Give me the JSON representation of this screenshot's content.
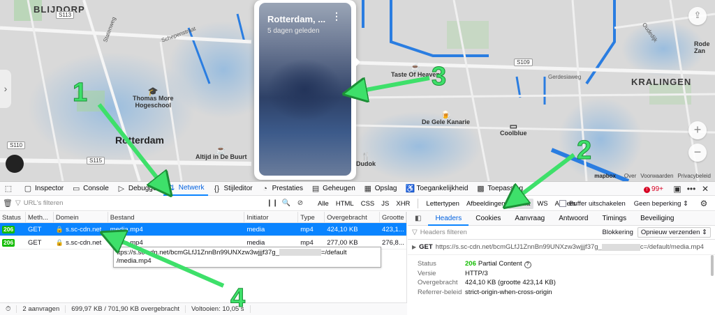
{
  "map": {
    "districts": [
      "BLIJDORP",
      "KRALINGEN",
      "Rotterdam"
    ],
    "road_badges": [
      "S113",
      "S110",
      "S109",
      "S115"
    ],
    "streets": [
      "Statenweg",
      "Schepenstraat",
      "Oudedijk",
      "Gerdesiaweg"
    ],
    "pois": [
      {
        "name": "Thomas More\nHogeschool",
        "icon": "graduation-cap-icon"
      },
      {
        "name": "Altijd in De Buurt",
        "icon": "coffee-icon"
      },
      {
        "name": "Taste Of Heaven",
        "icon": "coffee-icon"
      },
      {
        "name": "De Gele Kanarie",
        "icon": "beer-icon"
      },
      {
        "name": "Coolblue",
        "icon": "shop-icon"
      },
      {
        "name": "Dudok",
        "icon": "restaurant-icon"
      }
    ],
    "corner_label": "Rode\nZan",
    "attribution": {
      "brand": "mapbox",
      "links": [
        "Over",
        "Voorwaarden",
        "Privacybeleid"
      ]
    },
    "zoom_in": "+",
    "zoom_out": "−",
    "share_icon": "share-icon",
    "story": {
      "title": "Rotterdam, ...",
      "subtitle": "5 dagen geleden",
      "menu": "⋮"
    }
  },
  "devtools": {
    "tabs": [
      {
        "label": "Inspector",
        "icon": "inspector-icon"
      },
      {
        "label": "Console",
        "icon": "console-icon"
      },
      {
        "label": "Debugger",
        "icon": "debugger-icon"
      },
      {
        "label": "Netwerk",
        "icon": "network-icon",
        "active": true
      },
      {
        "label": "Stijleditor",
        "icon": "style-editor-icon"
      },
      {
        "label": "Prestaties",
        "icon": "performance-icon"
      },
      {
        "label": "Geheugen",
        "icon": "memory-icon"
      },
      {
        "label": "Opslag",
        "icon": "storage-icon"
      },
      {
        "label": "Toegankelijkheid",
        "icon": "accessibility-icon"
      },
      {
        "label": "Toepassing",
        "icon": "application-icon"
      }
    ],
    "error_count": "99+",
    "filter": {
      "placeholder": "URL's filteren",
      "types": [
        "Alle",
        "HTML",
        "CSS",
        "JS",
        "XHR",
        "Lettertypen",
        "Afbeeldingen",
        "Media",
        "WS",
        "Anders"
      ],
      "selected_type": "Media",
      "disable_cache_label": "Buffer uitschakelen",
      "throttle_label": "Geen beperking ⇕"
    },
    "table": {
      "headers": [
        "Status",
        "Meth...",
        "Domein",
        "Bestand",
        "Initiator",
        "Type",
        "Overgebracht",
        "Grootte"
      ],
      "rows": [
        {
          "status": "206",
          "method": "GET",
          "domain": "s.sc-cdn.net",
          "file": "media.mp4",
          "initiator": "media",
          "type": "mp4",
          "transferred": "424,10 KB",
          "size": "423,1..."
        },
        {
          "status": "206",
          "method": "GET",
          "domain": "s.sc-cdn.net",
          "file": "media.mp4",
          "initiator": "media",
          "type": "mp4",
          "transferred": "277,00 KB",
          "size": "276,8..."
        }
      ],
      "tooltip_line1a": "ttps://s.sc-cdn.net/bcmGLfJ1ZnnBn99UNXzw3wjjjf37g_",
      "tooltip_line1b": "=/default",
      "tooltip_line2": "/media.mp4"
    },
    "statusbar": {
      "requests": "2 aanvragen",
      "transferred": "699,97 KB / 701,90 KB overgebracht",
      "finished": "Voltooien: 10,05 s"
    },
    "details": {
      "tabs": [
        "Headers",
        "Cookies",
        "Aanvraag",
        "Antwoord",
        "Timings",
        "Beveiliging"
      ],
      "active_tab": "Headers",
      "filter_placeholder": "Headers filteren",
      "block_label": "Blokkering",
      "resend_label": "Opnieuw verzenden ⇕",
      "request_method": "GET",
      "request_url_a": "https://s.sc-cdn.net/bcmGLfJ1ZnnBn99UNXzw3wjjjf37g_",
      "request_url_b": "c=/default/media.mp4",
      "fields": [
        {
          "key": "Status",
          "code": "206",
          "value": "Partial Content"
        },
        {
          "key": "Versie",
          "value": "HTTP/3"
        },
        {
          "key": "Overgebracht",
          "value": "424,10 KB (grootte 423,14 KB)"
        },
        {
          "key": "Referrer-beleid",
          "value": "strict-origin-when-cross-origin"
        }
      ]
    }
  },
  "annotations": [
    "1",
    "2",
    "3",
    "4"
  ],
  "colors": {
    "accent": "#0a84ff",
    "status_ok": "#12bc00",
    "arrow": "#3ee06a"
  }
}
